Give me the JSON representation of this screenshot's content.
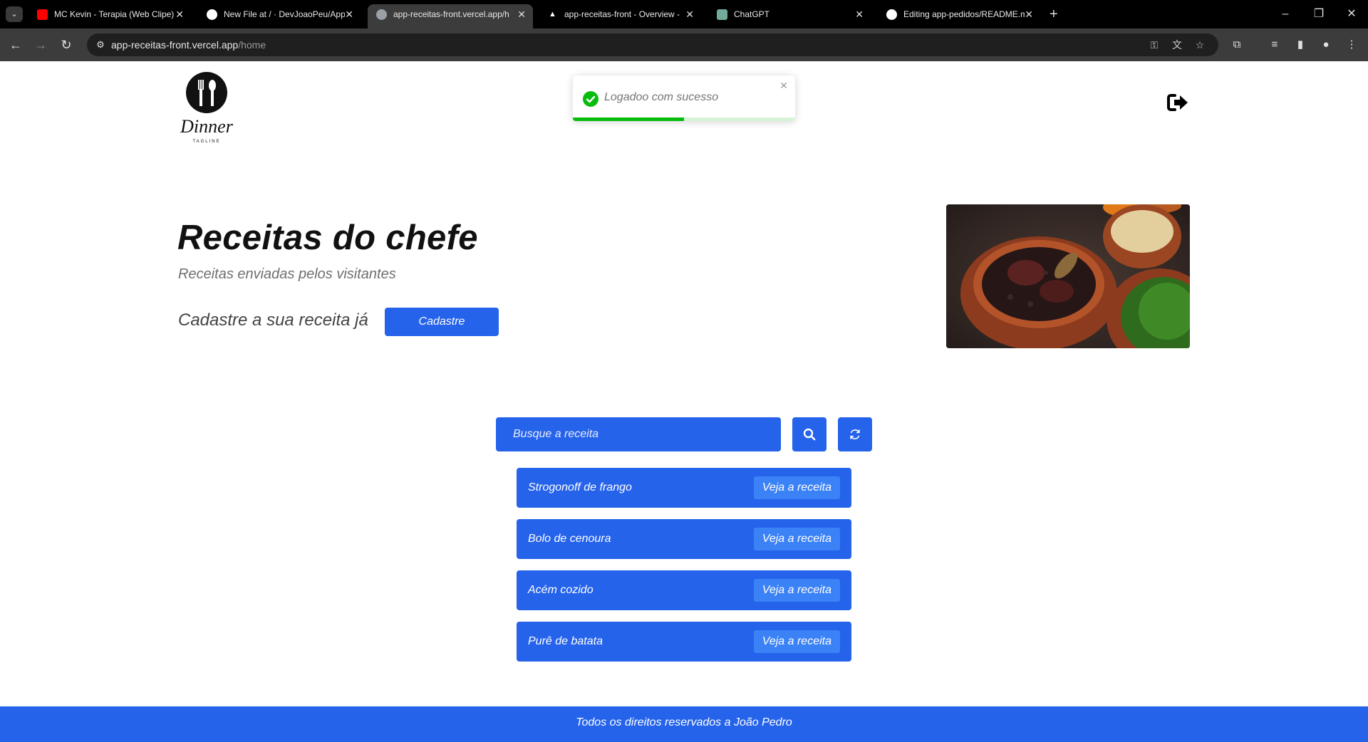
{
  "browser": {
    "tabs": [
      {
        "title": "MC Kevin - Terapia (Web Clipe)",
        "favicon": "youtube-icon"
      },
      {
        "title": "New File at / · DevJoaoPeu/App",
        "favicon": "github-icon"
      },
      {
        "title": "app-receitas-front.vercel.app/h",
        "favicon": "globe-icon",
        "active": true
      },
      {
        "title": "app-receitas-front - Overview -",
        "favicon": "vercel-icon"
      },
      {
        "title": "ChatGPT",
        "favicon": "chatgpt-icon"
      },
      {
        "title": "Editing app-pedidos/README.m",
        "favicon": "github-icon"
      }
    ],
    "address": {
      "host": "app-receitas-front.vercel.app",
      "path": "/home"
    }
  },
  "header": {
    "logo_text": "Dinner",
    "logo_tagline": "TAGLINE"
  },
  "toast": {
    "message": "Logadoo com sucesso",
    "progress": 0.5
  },
  "hero": {
    "title": "Receitas do chefe",
    "subtitle": "Receitas enviadas pelos visitantes",
    "cta_text": "Cadastre a sua receita já",
    "cta_button": "Cadastre"
  },
  "search": {
    "placeholder": "Busque a receita"
  },
  "recipes": [
    {
      "name": "Strogonoff de frango",
      "button": "Veja a receita"
    },
    {
      "name": "Bolo de cenoura",
      "button": "Veja a receita"
    },
    {
      "name": "Acém cozido",
      "button": "Veja a receita"
    },
    {
      "name": "Purê de batata",
      "button": "Veja a receita"
    }
  ],
  "footer": {
    "text": "Todos os direitos reservados a João Pedro"
  },
  "colors": {
    "primary": "#2563eb",
    "button_light": "#3b82f6",
    "success": "#07bc0c"
  }
}
